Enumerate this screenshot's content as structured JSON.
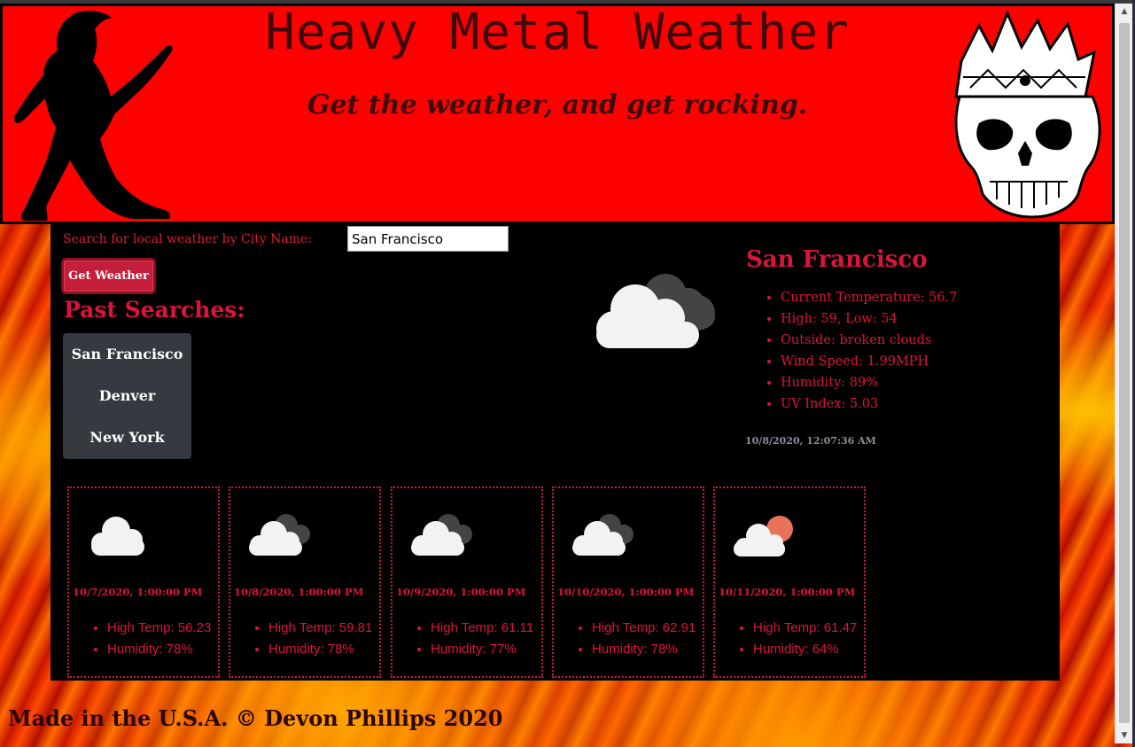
{
  "header": {
    "title": "Heavy Metal Weather",
    "subtitle": "Get the weather, and get rocking."
  },
  "search": {
    "label": "Search for local weather by City Name:",
    "value": "San Francisco",
    "button_label": "Get Weather"
  },
  "past_searches": {
    "title": "Past Searches:",
    "items": [
      "San Francisco",
      "Denver",
      "New York"
    ]
  },
  "current": {
    "city": "San Francisco",
    "icon": "broken-clouds-icon",
    "details": [
      "Current Temperature: 56.7",
      "High: 59, Low: 54",
      "Outside: broken clouds",
      "Wind Speed: 1.99MPH",
      "Humidity: 89%",
      "UV Index: 5.03"
    ],
    "timestamp": "10/8/2020, 12:07:36 AM"
  },
  "forecast": [
    {
      "icon": "cloud-icon",
      "date": "10/7/2020, 1:00:00 PM",
      "high": "High Temp: 56.23",
      "humidity": "Humidity: 78%"
    },
    {
      "icon": "broken-clouds-icon",
      "date": "10/8/2020, 1:00:00 PM",
      "high": "High Temp: 59.81",
      "humidity": "Humidity: 78%"
    },
    {
      "icon": "broken-clouds-icon",
      "date": "10/9/2020, 1:00:00 PM",
      "high": "High Temp: 61.11",
      "humidity": "Humidity: 77%"
    },
    {
      "icon": "broken-clouds-icon",
      "date": "10/10/2020, 1:00:00 PM",
      "high": "High Temp: 62.91",
      "humidity": "Humidity: 78%"
    },
    {
      "icon": "partly-cloudy-sun-icon",
      "date": "10/11/2020, 1:00:00 PM",
      "high": "High Temp: 61.47",
      "humidity": "Humidity: 64%"
    }
  ],
  "footer": {
    "text": "Made in the U.S.A. © Devon Phillips 2020"
  },
  "colors": {
    "header_bg": "#ff0000",
    "accent": "#dc143c",
    "button": "#c41e3a",
    "panel": "#000000",
    "past_list_bg": "#343a40"
  }
}
